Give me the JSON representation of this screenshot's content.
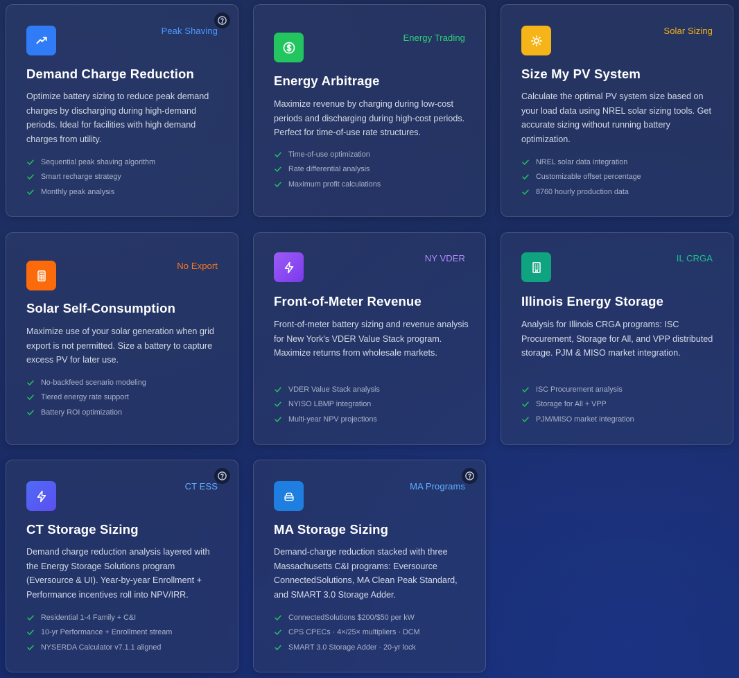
{
  "colors": {
    "blue": "#2f7cf6",
    "green": "#22c55e",
    "amber": "#f5b417",
    "orange": "#fb6a0b",
    "violet": "#8b5cf6",
    "teal": "#10a37f",
    "indigo": "#5a61f3",
    "sky": "#1e7fe0",
    "check": "#22c55e"
  },
  "cards": [
    {
      "tag": "Peak Shaving",
      "title": "Demand Charge Reduction",
      "description": "Optimize battery sizing to reduce peak demand charges by discharging during high-demand periods. Ideal for facilities with high demand charges from utility.",
      "icon": "trending-up-icon",
      "features": [
        "Sequential peak shaving algorithm",
        "Smart recharge strategy",
        "Monthly peak analysis"
      ],
      "has_help": true
    },
    {
      "tag": "Energy Trading",
      "title": "Energy Arbitrage",
      "description": "Maximize revenue by charging during low-cost periods and discharging during high-cost periods. Perfect for time-of-use rate structures.",
      "icon": "dollar-icon",
      "features": [
        "Time-of-use optimization",
        "Rate differential analysis",
        "Maximum profit calculations"
      ],
      "has_help": false
    },
    {
      "tag": "Solar Sizing",
      "title": "Size My PV System",
      "description": "Calculate the optimal PV system size based on your load data using NREL solar sizing tools. Get accurate sizing without running battery optimization.",
      "icon": "sun-icon",
      "features": [
        "NREL solar data integration",
        "Customizable offset percentage",
        "8760 hourly production data"
      ],
      "has_help": false
    },
    {
      "tag": "No Export",
      "title": "Solar Self-Consumption",
      "description": "Maximize use of your solar generation when grid export is not permitted. Size a battery to capture excess PV for later use.",
      "icon": "calculator-icon",
      "features": [
        "No-backfeed scenario modeling",
        "Tiered energy rate support",
        "Battery ROI optimization"
      ],
      "has_help": false
    },
    {
      "tag": "NY VDER",
      "title": "Front-of-Meter Revenue",
      "description": "Front-of-meter battery sizing and revenue analysis for New York's VDER Value Stack program. Maximize returns from wholesale markets.",
      "icon": "lightning-icon",
      "features": [
        "VDER Value Stack analysis",
        "NYISO LBMP integration",
        "Multi-year NPV projections"
      ],
      "has_help": false
    },
    {
      "tag": "IL CRGA",
      "title": "Illinois Energy Storage",
      "description": "Analysis for Illinois CRGA programs: ISC Procurement, Storage for All, and VPP distributed storage. PJM & MISO market integration.",
      "icon": "building-icon",
      "features": [
        "ISC Procurement analysis",
        "Storage for All + VPP",
        "PJM/MISO market integration"
      ],
      "has_help": false
    },
    {
      "tag": "CT ESS",
      "title": "CT Storage Sizing",
      "description": "Demand charge reduction analysis layered with the Energy Storage Solutions program (Eversource & UI). Year-by-year Enrollment + Performance incentives roll into NPV/IRR.",
      "icon": "lightning-icon",
      "features": [
        "Residential 1-4 Family + C&I",
        "10-yr Performance + Enrollment stream",
        "NYSERDA Calculator v7.1.1 aligned"
      ],
      "has_help": true
    },
    {
      "tag": "MA Programs",
      "title": "MA Storage Sizing",
      "description": "Demand-charge reduction stacked with three Massachusetts C&I programs: Eversource ConnectedSolutions, MA Clean Peak Standard, and SMART 3.0 Storage Adder.",
      "icon": "battery-stack-icon",
      "features": [
        "ConnectedSolutions $200/$50 per kW",
        "CPS CPECs · 4×/25× multipliers · DCM",
        "SMART 3.0 Storage Adder · 20-yr lock"
      ],
      "has_help": true
    }
  ]
}
